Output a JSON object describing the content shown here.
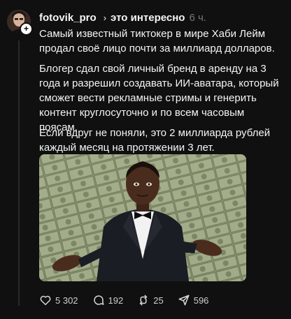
{
  "post": {
    "username": "fotovik_pro",
    "topic": "это интересно",
    "time": "6 ч.",
    "paragraphs": [
      "Самый известный тиктокер в мире Хаби Лейм продал своё лицо почти за миллиард долларов.",
      "Блогер сдал свой личный бренд в аренду на 3 года и разрешил создавать ИИ-аватара, который сможет вести рекламные стримы и генерить контент круглосуточно и по всем часовым поясам.",
      "Если вдруг не поняли, это 2 миллиарда рублей каждый месяц на протяжении 3 лет."
    ]
  },
  "actions": {
    "likes": "5 302",
    "comments": "192",
    "reposts": "25",
    "shares": "596"
  },
  "icons": {
    "topic_separator": "chevron-right-icon",
    "follow": "plus-icon",
    "like": "heart-icon",
    "comment": "comment-icon",
    "repost": "repost-icon",
    "share": "send-icon"
  },
  "colors": {
    "background": "#101010",
    "text": "#f3f5f7",
    "muted": "#777777"
  }
}
